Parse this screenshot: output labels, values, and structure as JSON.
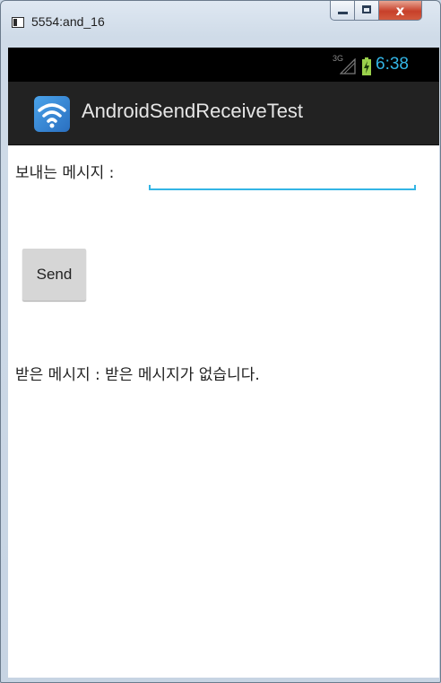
{
  "window": {
    "title": "5554:and_16",
    "close_glyph": "x"
  },
  "status_bar": {
    "network": "3G",
    "time": "6:38",
    "accent_color": "#33b5e5"
  },
  "action_bar": {
    "title": "AndroidSendReceiveTest",
    "icon": "wifi-icon"
  },
  "form": {
    "send_label": "보내는 메시지 :",
    "message_value": "",
    "send_button": "Send",
    "received_label": "받은 메시지 : 받은 메시지가 없습니다."
  }
}
